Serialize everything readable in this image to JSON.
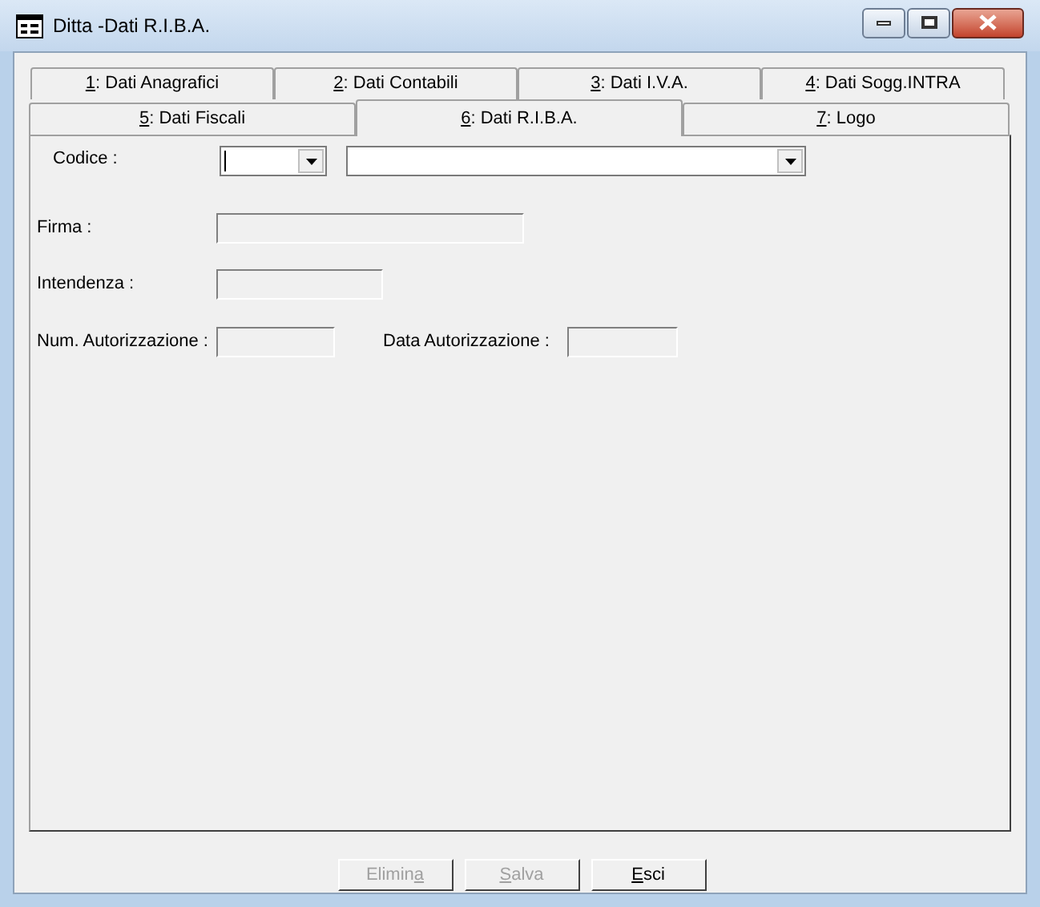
{
  "window": {
    "title": "Ditta -Dati R.I.B.A."
  },
  "tabs_row_1": [
    {
      "mnemonic": "1",
      "after": ": Dati Anagrafici",
      "selected": false
    },
    {
      "mnemonic": "2",
      "after": ": Dati Contabili",
      "selected": false
    },
    {
      "mnemonic": "3",
      "after": ": Dati I.V.A.",
      "selected": false
    },
    {
      "mnemonic": "4",
      "after": ": Dati Sogg.INTRA",
      "selected": false
    }
  ],
  "tabs_row_2": [
    {
      "mnemonic": "5",
      "after": ": Dati Fiscali",
      "selected": false
    },
    {
      "mnemonic": "6",
      "after": ": Dati R.I.B.A.",
      "selected": true
    },
    {
      "mnemonic": "7",
      "after": ": Logo",
      "selected": false
    }
  ],
  "codice": {
    "label": "Codice :"
  },
  "firma": {
    "label": "Firma :"
  },
  "intendenza": {
    "label": "Intendenza :"
  },
  "num_autorizzazione": {
    "label": "Num. Autorizzazione :"
  },
  "data_autorizzazione": {
    "label": "Data Autorizzazione :"
  },
  "buttons": [
    {
      "before": "Elimin",
      "mnemonic": "a",
      "disabled": true
    },
    {
      "mnemonic": "S",
      "after": "alva",
      "disabled": true
    },
    {
      "mnemonic": "E",
      "after": "sci",
      "disabled": false
    }
  ]
}
